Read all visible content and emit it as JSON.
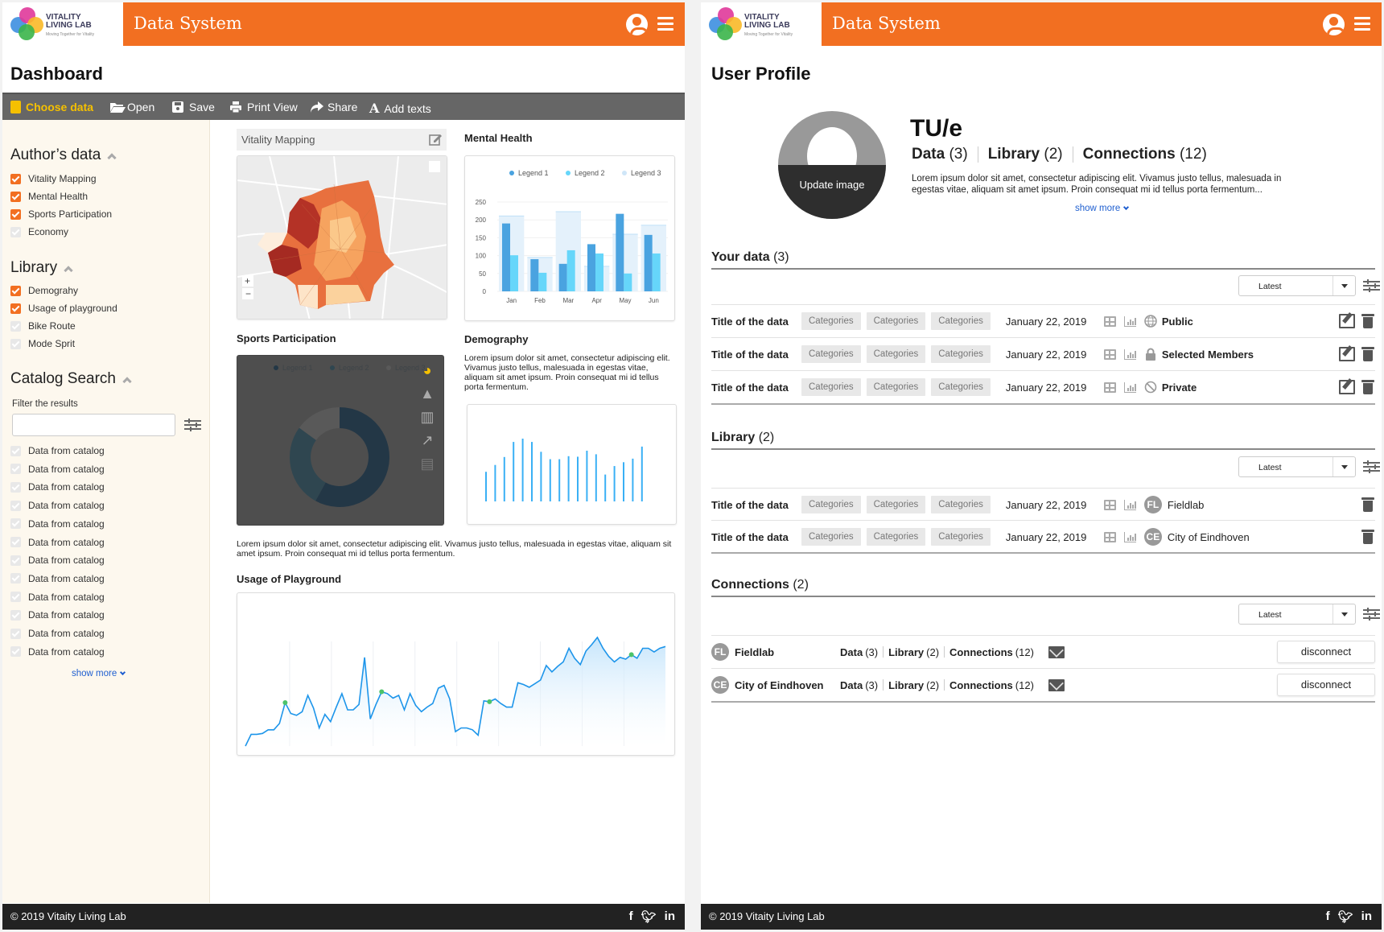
{
  "header": {
    "logo_line1": "VITALITY",
    "logo_line2": "LIVING LAB",
    "logo_tagline": "Moving Together for Vitality",
    "title": "Data System"
  },
  "colors": {
    "brand": "#f26f21",
    "toolbar": "#666666",
    "accent_yellow": "#f5c000",
    "link": "#1f5fd0",
    "footer": "#222222"
  },
  "dashboard": {
    "page_title": "Dashboard",
    "toolbar": [
      {
        "label": "Choose data",
        "icon": "choose-data-icon",
        "active": true
      },
      {
        "label": "Open",
        "icon": "folder-open-icon"
      },
      {
        "label": "Save",
        "icon": "save-icon"
      },
      {
        "label": "Print View",
        "icon": "print-icon"
      },
      {
        "label": "Share",
        "icon": "share-icon"
      },
      {
        "label": "Add texts",
        "icon": "text-icon"
      }
    ],
    "sidebar": {
      "authors_data": {
        "title": "Author’s data",
        "items": [
          {
            "label": "Vitality Mapping",
            "checked": true
          },
          {
            "label": "Mental Health",
            "checked": true
          },
          {
            "label": "Sports Participation",
            "checked": true
          },
          {
            "label": "Economy",
            "checked": false
          }
        ]
      },
      "library": {
        "title": "Library",
        "items": [
          {
            "label": "Demograhy",
            "checked": true
          },
          {
            "label": "Usage of playground",
            "checked": true
          },
          {
            "label": "Bike Route",
            "checked": false
          },
          {
            "label": "Mode Sprit",
            "checked": false
          }
        ]
      },
      "catalog": {
        "title": "Catalog Search",
        "filter_label": "Filter the results",
        "filter_value": "",
        "items": [
          "Data from catalog",
          "Data from catalog",
          "Data from catalog",
          "Data from catalog",
          "Data from catalog",
          "Data from catalog",
          "Data from catalog",
          "Data from catalog",
          "Data from catalog",
          "Data from catalog",
          "Data from catalog",
          "Data from catalog"
        ],
        "show_more": "show more"
      }
    },
    "widgets": {
      "vitality_mapping": {
        "title": "Vitality Mapping"
      },
      "mental_health": {
        "title": "Mental Health"
      },
      "sports": {
        "title": "Sports Participation"
      },
      "demography": {
        "title": "Demography",
        "text": "Lorem ipsum dolor sit amet, consectetur adipiscing elit. Vivamus justo tellus, malesuada in egestas vitae, aliquam sit amet ipsum. Proin consequat mi id tellus porta fermentum."
      },
      "caption": "Lorem ipsum dolor sit amet, consectetur adipiscing elit. Vivamus justo tellus, malesuada in egestas vitae, aliquam sit amet ipsum. Proin consequat mi id tellus porta fermentum.",
      "playground": {
        "title": "Usage of Playground"
      }
    }
  },
  "chart_data": [
    {
      "type": "bar",
      "title": "Mental Health",
      "categories": [
        "Jan",
        "Feb",
        "Mar",
        "Apr",
        "May",
        "Jun"
      ],
      "series": [
        {
          "name": "Legend 1",
          "color": "#4aa3e0",
          "values": [
            190,
            90,
            77,
            132,
            217,
            158
          ]
        },
        {
          "name": "Legend 2",
          "color": "#66d6fa",
          "values": [
            101,
            52,
            115,
            106,
            50,
            106
          ]
        },
        {
          "name": "Legend 3",
          "color": "#dceefb",
          "values": [
            211,
            95,
            223,
            70,
            160,
            185
          ]
        }
      ],
      "yticks": [
        0,
        50,
        100,
        150,
        200,
        250
      ],
      "ylim": [
        0,
        250
      ],
      "legend": "top"
    },
    {
      "type": "pie",
      "title": "Sports Participation",
      "donut": true,
      "series": [
        {
          "name": "Legend 1",
          "value": 58
        },
        {
          "name": "Legend 2",
          "value": 27
        },
        {
          "name": "Legend 3",
          "value": 15
        }
      ],
      "legend": "top"
    },
    {
      "type": "bar",
      "title": "Demography",
      "values": [
        108,
        133,
        162,
        217,
        229,
        217,
        181,
        154,
        154,
        165,
        163,
        185,
        172,
        98,
        129,
        143,
        156,
        200
      ]
    },
    {
      "type": "area",
      "title": "Usage of Playground",
      "values": [
        0,
        13,
        13,
        14,
        18,
        18,
        25,
        48,
        36,
        34,
        38,
        56,
        42,
        20,
        35,
        27,
        43,
        58,
        40,
        40,
        46,
        98,
        30,
        46,
        60,
        58,
        53,
        56,
        40,
        58,
        45,
        38,
        43,
        47,
        64,
        67,
        52,
        16,
        20,
        20,
        18,
        12,
        50,
        49,
        52,
        47,
        43,
        43,
        70,
        68,
        65,
        69,
        73,
        89,
        82,
        88,
        93,
        108,
        97,
        90,
        105,
        112,
        120,
        108,
        99,
        93,
        98,
        96,
        101,
        97,
        108,
        108,
        104,
        108,
        110
      ],
      "markers": [
        7,
        24,
        43,
        68
      ]
    }
  ],
  "sports_chart_types": [
    "pie-chart-icon",
    "area-chart-icon",
    "bar-chart-icon",
    "line-chart-icon",
    "map-icon"
  ],
  "profile": {
    "page_title": "User Profile",
    "update_image": "Update image",
    "name": "TU/e",
    "stats": [
      {
        "label": "Data",
        "count": "(3)"
      },
      {
        "label": "Library",
        "count": "(2)"
      },
      {
        "label": "Connections",
        "count": "(12)"
      }
    ],
    "bio": "Lorem ipsum dolor sit amet, consectetur adipiscing elit. Vivamus justo tellus, malesuada in egestas vitae, aliquam sit amet ipsum. Proin consequat mi id tellus porta fermentum...",
    "show_more": "show more",
    "sort_value": "Latest",
    "your_data": {
      "title": "Your data",
      "count": "(3)",
      "rows": [
        {
          "title": "Title of the data",
          "cats": [
            "Categories",
            "Categories",
            "Categories"
          ],
          "date": "January 22, 2019",
          "visibility": "Public",
          "icon": "globe-icon"
        },
        {
          "title": "Title of the data",
          "cats": [
            "Categories",
            "Categories",
            "Categories"
          ],
          "date": "January 22, 2019",
          "visibility": "Selected Members",
          "icon": "lock-icon"
        },
        {
          "title": "Title of the data",
          "cats": [
            "Categories",
            "Categories",
            "Categories"
          ],
          "date": "January 22, 2019",
          "visibility": "Private",
          "icon": "private-icon"
        }
      ]
    },
    "library": {
      "title": "Library",
      "count": "(2)",
      "rows": [
        {
          "title": "Title of the data",
          "cats": [
            "Categories",
            "Categories",
            "Categories"
          ],
          "date": "January 22, 2019",
          "owner": "Fieldlab",
          "initials": "FL"
        },
        {
          "title": "Title of the data",
          "cats": [
            "Categories",
            "Categories",
            "Categories"
          ],
          "date": "January 22, 2019",
          "owner": "City of Eindhoven",
          "initials": "CE"
        }
      ]
    },
    "connections": {
      "title": "Connections",
      "count": "(2)",
      "disconnect": "disconnect",
      "rows": [
        {
          "name": "Fieldlab",
          "initials": "FL",
          "data": "Data",
          "data_c": "(3)",
          "lib": "Library",
          "lib_c": "(2)",
          "conn": "Connections",
          "conn_c": "(12)"
        },
        {
          "name": "City of Eindhoven",
          "initials": "CE",
          "data": "Data",
          "data_c": "(3)",
          "lib": "Library",
          "lib_c": "(2)",
          "conn": "Connections",
          "conn_c": "(12)"
        }
      ]
    }
  },
  "footer": {
    "copyright": "© 2019 Vitaity Living Lab",
    "social": [
      "f",
      "t",
      "in"
    ]
  }
}
